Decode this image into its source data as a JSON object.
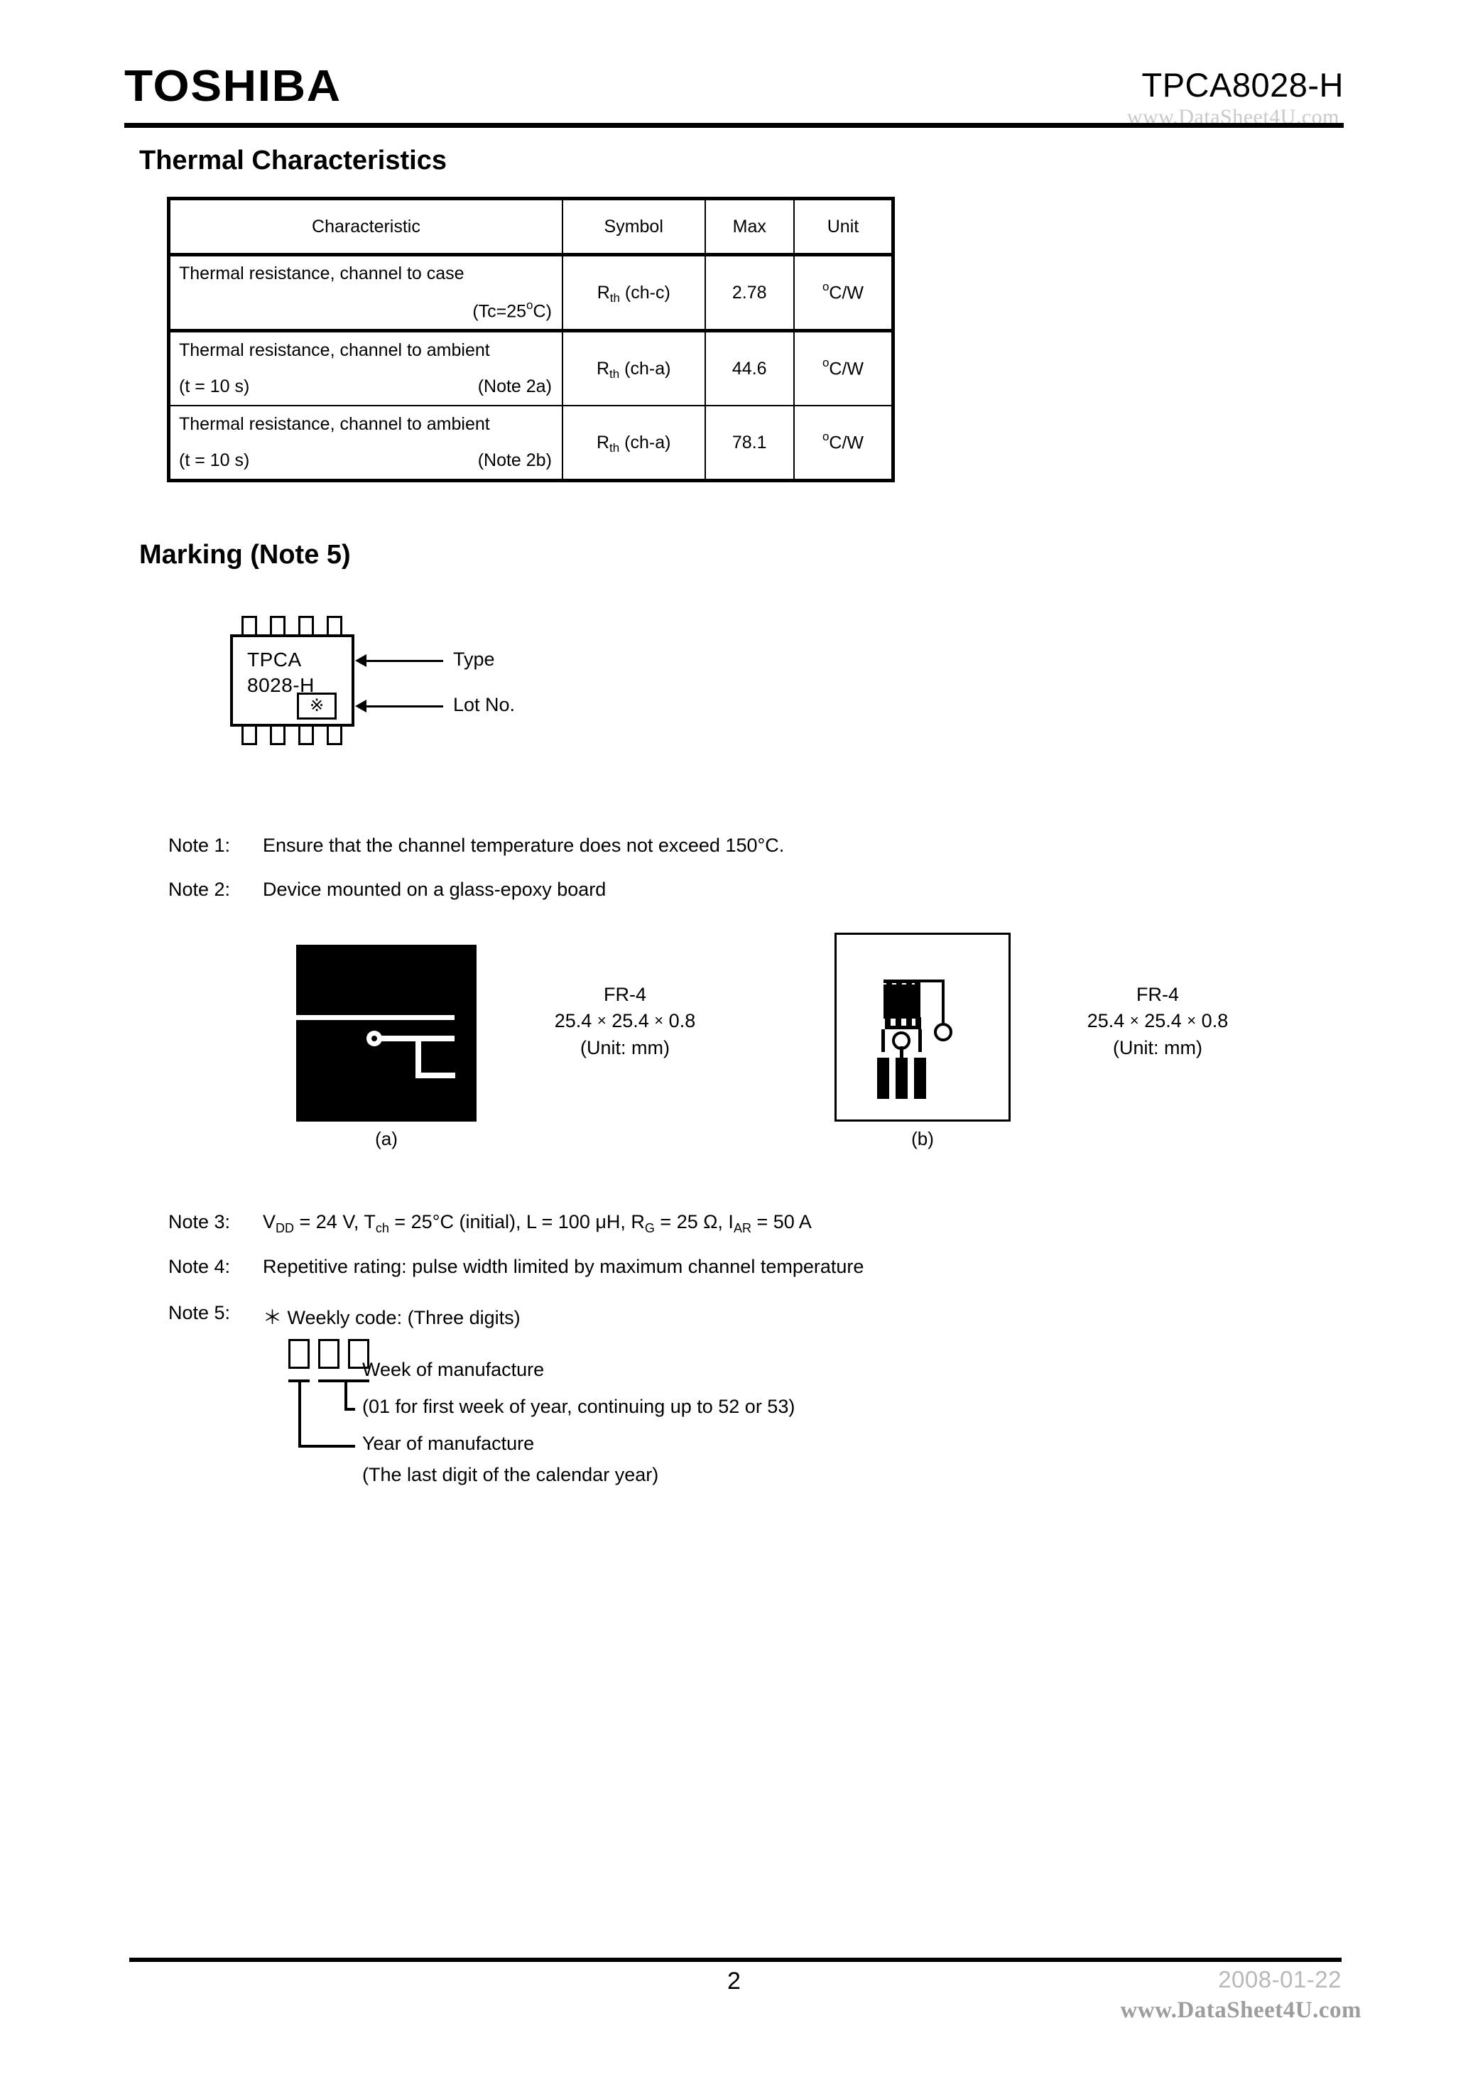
{
  "header": {
    "logo": "TOSHIBA",
    "part_number": "TPCA8028-H",
    "watermark": "www.DataSheet4U.com"
  },
  "sections": {
    "thermal_title": "Thermal Characteristics",
    "marking_title": "Marking (Note 5)"
  },
  "thermal_table": {
    "columns": [
      "Characteristic",
      "Symbol",
      "Max",
      "Unit"
    ],
    "rows": [
      {
        "characteristic_line1": "Thermal resistance, channel to case",
        "characteristic_line2_left": "",
        "characteristic_line2_right": "(Tc=25",
        "condition_suffix": "C)",
        "symbol_main": "R",
        "symbol_sub": "th",
        "symbol_tail": " (ch-c)",
        "max": "2.78",
        "unit": "C/W"
      },
      {
        "characteristic_line1": "Thermal resistance, channel to ambient",
        "characteristic_line2_left": "(t = 10 s)",
        "characteristic_line2_right": "(Note 2a)",
        "symbol_main": "R",
        "symbol_sub": "th",
        "symbol_tail": " (ch-a)",
        "max": "44.6",
        "unit": "C/W"
      },
      {
        "characteristic_line1": "Thermal resistance, channel to ambient",
        "characteristic_line2_left": "(t = 10 s)",
        "characteristic_line2_right": "(Note 2b)",
        "symbol_main": "R",
        "symbol_sub": "th",
        "symbol_tail": " (ch-a)",
        "max": "78.1",
        "unit": "C/W"
      }
    ]
  },
  "marking": {
    "package_line1": "TPCA",
    "package_line2": "8028-H",
    "lot_symbol": "※",
    "callout_type": "Type",
    "callout_lot": "Lot No."
  },
  "notes": {
    "note1_label": "Note 1:",
    "note1_text": "Ensure that the channel temperature does not exceed 150°C.",
    "note2_label": "Note 2:",
    "note2_text": "Device mounted on a glass-epoxy board",
    "note3_label": "Note 3:",
    "note4_label": "Note 4:",
    "note4_text": "Repetitive rating: pulse width limited by maximum channel temperature",
    "note5_label": "Note 5:",
    "note5_text": "＊ Weekly code:  (Three digits)"
  },
  "note3": {
    "v_sym": "V",
    "v_sub": "DD",
    "v_val": " = 24 V, ",
    "t_sym": "T",
    "t_sub": "ch",
    "t_val": " = 25°C (initial), L = 100 μH, ",
    "rg_sym": "R",
    "rg_sub": "G",
    "rg_val": " = 25 Ω, ",
    "iar_sym": "I",
    "iar_sub": "AR",
    "iar_val": " = 50 A"
  },
  "boards": {
    "a": {
      "caption": "(a)",
      "material": "FR-4",
      "dimensions_x": "25.4",
      "dimensions_y": "25.4",
      "dimensions_z": "0.8",
      "unit_note": "(Unit: mm)"
    },
    "b": {
      "caption": "(b)",
      "material": "FR-4",
      "dimensions_x": "25.4",
      "dimensions_y": "25.4",
      "dimensions_z": "0.8",
      "unit_note": "(Unit: mm)"
    }
  },
  "weekly_code": {
    "week_label": "Week of manufacture",
    "week_detail": "(01 for first week of year, continuing up to 52 or 53)",
    "year_label": "Year of manufacture",
    "year_detail": "(The last digit of the calendar year)"
  },
  "footer": {
    "page_number": "2",
    "date": "2008-01-22",
    "watermark": "www.DataSheet4U.com"
  }
}
